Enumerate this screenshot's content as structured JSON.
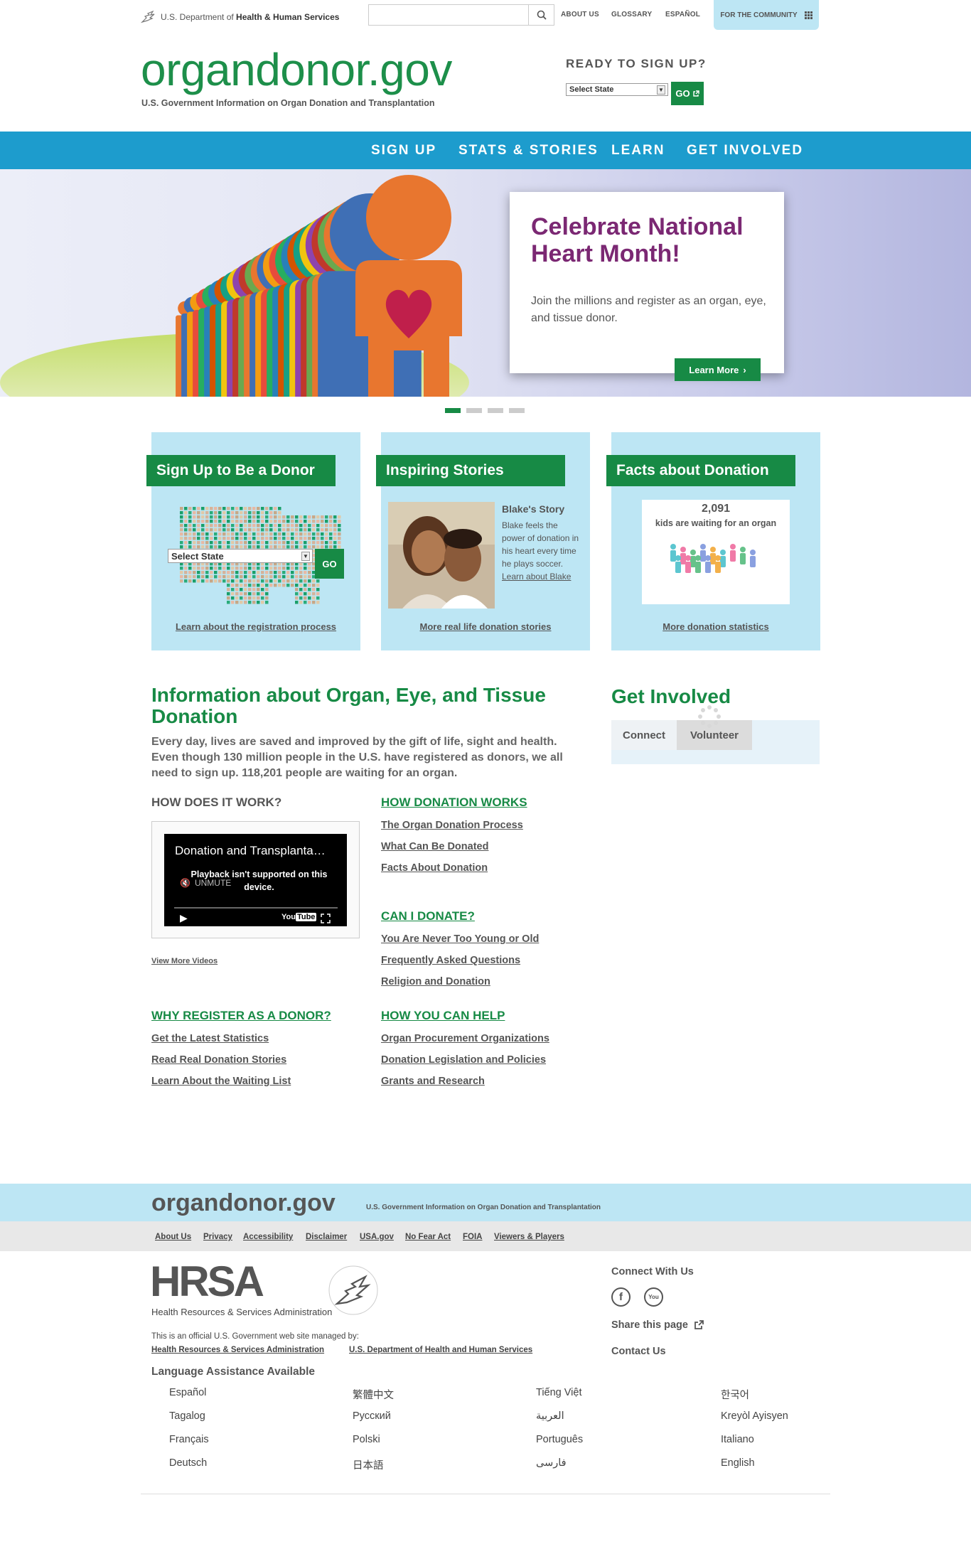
{
  "topbar": {
    "hhs_prefix": "U.S. Department of ",
    "hhs_bold": "Health & Human Services",
    "search_placeholder": "",
    "links": [
      "ABOUT US",
      "GLOSSARY",
      "ESPAÑOL"
    ],
    "community": "FOR THE COMMUNITY"
  },
  "header": {
    "logo": "organdonor.gov",
    "tagline": "U.S. Government Information on Organ Donation and Transplantation",
    "ready_title": "READY TO SIGN UP?",
    "state_select": "Select State",
    "go": "GO"
  },
  "nav": [
    "SIGN UP",
    "STATS & STORIES",
    "LEARN",
    "GET INVOLVED"
  ],
  "hero": {
    "title": "Celebrate National Heart Month!",
    "text": "Join the millions and register as an organ, eye, and tissue donor.",
    "cta": "Learn More"
  },
  "features": {
    "signup": {
      "title": "Sign Up to Be a Donor",
      "state_select": "Select State",
      "go": "GO",
      "link": "Learn about the registration process"
    },
    "stories": {
      "title": "Inspiring Stories",
      "story_title": "Blake's Story",
      "story_text": "Blake feels the power of donation in his heart every time he plays soccer.",
      "story_link": "Learn about Blake",
      "link": "More real life donation stories"
    },
    "facts": {
      "title": "Facts about Donation",
      "count": "2,091",
      "count_text": "kids are waiting for an organ",
      "link": "More donation statistics"
    }
  },
  "info": {
    "title": "Information about Organ, Eye, and Tissue Donation",
    "text": "Every day, lives are saved and improved by the gift of life, sight and health. Even though 130 million people in the U.S. have registered as donors, we all need to sign up. 118,201 people are waiting for an organ.",
    "how_title": "HOW DOES IT WORK?",
    "video_title": "Donation and Transplanta…",
    "video_msg": "Playback isn't supported on this device.",
    "video_unmute": "UNMUTE",
    "view_more": "View More Videos",
    "how_works_title": "HOW DONATION WORKS",
    "how_works_links": [
      "The Organ Donation Process",
      "What Can Be Donated",
      "Facts About Donation"
    ],
    "can_donate_title": "CAN I DONATE?",
    "can_donate_links": [
      "You Are Never Too Young or Old",
      "Frequently Asked Questions",
      "Religion and Donation"
    ],
    "why_title": "WHY REGISTER AS A DONOR?",
    "why_links": [
      "Get the Latest Statistics",
      "Read Real Donation Stories",
      "Learn About the Waiting List"
    ],
    "help_title": "HOW YOU CAN HELP",
    "help_links": [
      "Organ Procurement Organizations",
      "Donation Legislation and Policies",
      "Grants and Research"
    ]
  },
  "get_involved": {
    "title": "Get Involved",
    "tabs": [
      "Connect",
      "Volunteer"
    ]
  },
  "footer": {
    "logo": "organdonor.gov",
    "tagline": "U.S. Government Information on Organ Donation and Transplantation",
    "links": [
      "About Us",
      "Privacy",
      "Accessibility",
      "Disclaimer",
      "USA.gov",
      "No Fear Act",
      "FOIA",
      "Viewers & Players"
    ],
    "hrsa": "HRSA",
    "hrsa_sub": "Health Resources & Services Administration",
    "official": "This is an official U.S. Government web site managed by:",
    "managed_links": [
      "Health Resources & Services Administration",
      "U.S. Department of Health and Human Services"
    ],
    "connect": "Connect With Us",
    "share": "Share this page",
    "contact": "Contact Us",
    "lang_title": "Language Assistance Available",
    "languages": [
      [
        "Español",
        "繁體中文",
        "Tiếng Việt",
        "한국어"
      ],
      [
        "Tagalog",
        "Русский",
        "العربية",
        "Kreyòl Ayisyen"
      ],
      [
        "Français",
        "Polski",
        "Português",
        "Italiano"
      ],
      [
        "Deutsch",
        "日本語",
        "فارسی",
        "English"
      ]
    ]
  },
  "colors": {
    "green": "#178a45",
    "nav_blue": "#1d9ccd",
    "light_blue": "#bde6f4",
    "purple": "#7b2873"
  }
}
